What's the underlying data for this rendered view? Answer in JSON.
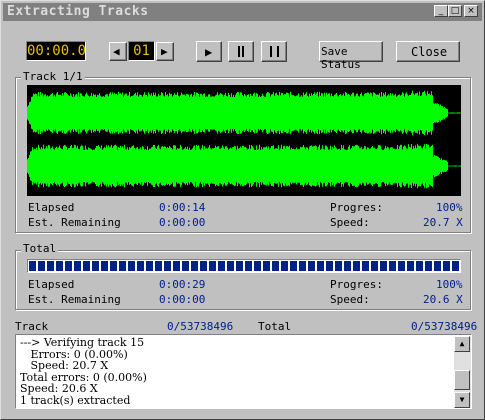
{
  "window": {
    "title": "Extracting Tracks",
    "controls": {
      "minimize": "_",
      "maximize": "□",
      "close": "×"
    }
  },
  "toolbar": {
    "time_display": "00:00.0",
    "track_display": "01",
    "prev_icon": "◀",
    "next_icon": "▶",
    "play_icon": "▶",
    "save_status_label": "Save Status",
    "close_label": "Close"
  },
  "track_group": {
    "title": "Track 1/1",
    "elapsed_label": "Elapsed",
    "elapsed_value": "0:00:14",
    "remaining_label": "Est. Remaining",
    "remaining_value": "0:00:00",
    "progress_label": "Progres:",
    "progress_value": "100%",
    "speed_label": "Speed:",
    "speed_value": "20.7 X",
    "waveform_color": "#00ff00"
  },
  "total_group": {
    "title": "Total",
    "elapsed_label": "Elapsed",
    "elapsed_value": "0:00:29",
    "remaining_label": "Est. Remaining",
    "remaining_value": "0:00:00",
    "progress_label": "Progres:",
    "progress_value": "100%",
    "speed_label": "Speed:",
    "speed_value": "20.6 X",
    "progress_fraction": 1.0,
    "progress_color": "#00208c"
  },
  "summary": {
    "track_label": "Track",
    "track_value": "0/53738496",
    "total_label": "Total",
    "total_value": "0/53738496"
  },
  "log": {
    "lines": [
      "---> Verifying track 15",
      "   Errors: 0 (0.00%)",
      "   Speed: 20.7 X",
      "Total errors: 0 (0.00%)",
      "Speed: 20.6 X",
      "1 track(s) extracted"
    ]
  }
}
